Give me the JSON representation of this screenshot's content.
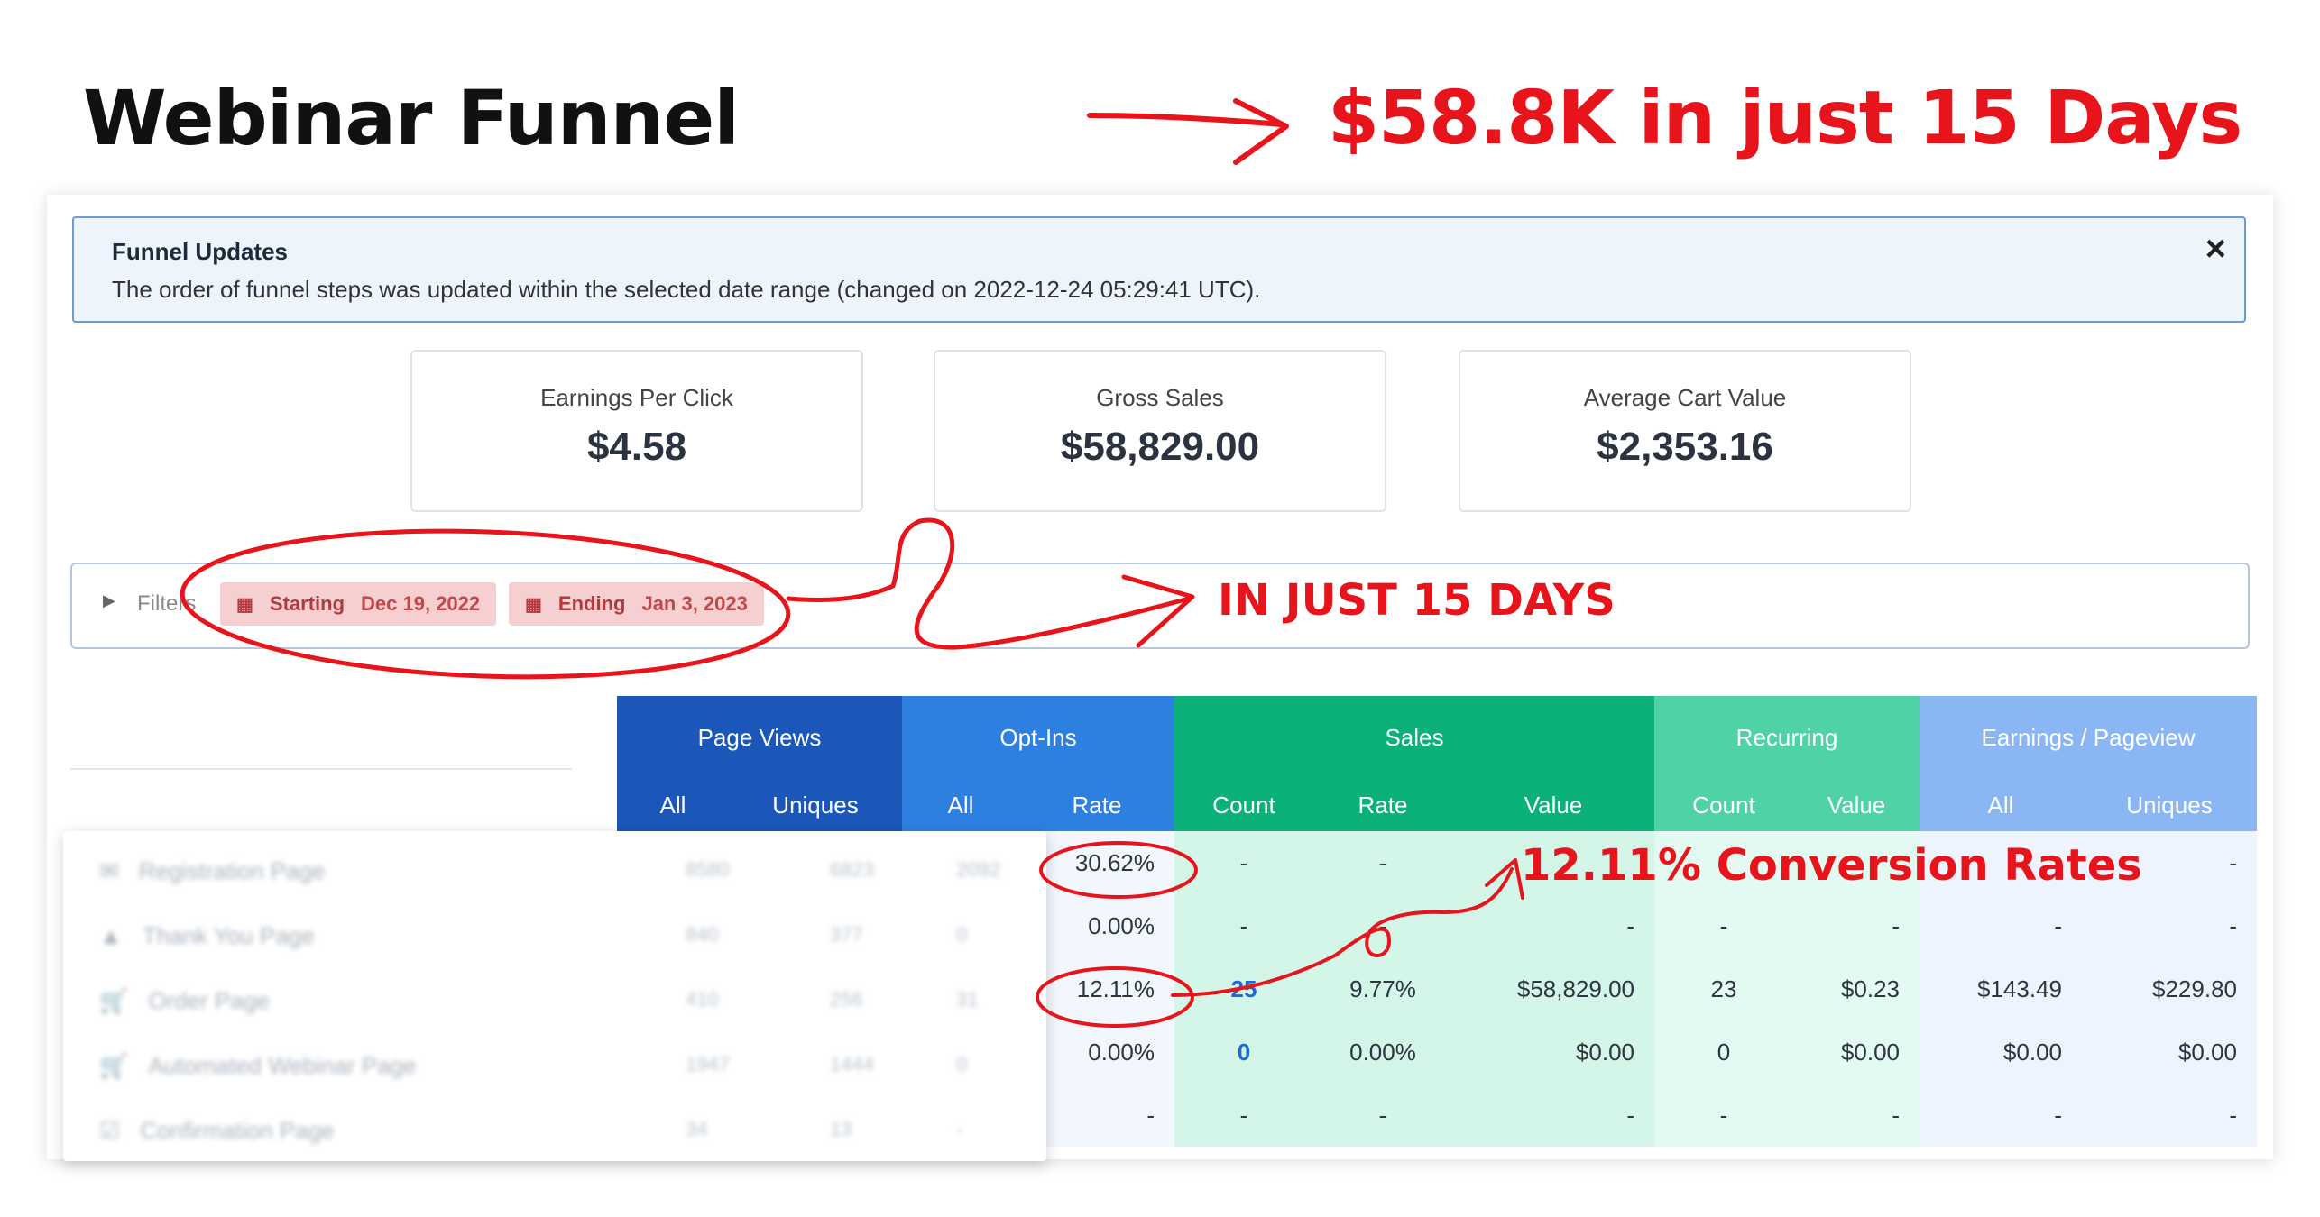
{
  "heading": "Webinar Funnel",
  "headline": "$58.8K in just 15 Days",
  "annotations": {
    "days": "IN JUST 15 DAYS",
    "conversion": "12.11% Conversion Rates"
  },
  "alert": {
    "title": "Funnel Updates",
    "text": "The order of funnel steps was updated within the selected date range (changed on 2022-12-24 05:29:41 UTC).",
    "close": "×"
  },
  "stats": [
    {
      "label": "Earnings Per Click",
      "value": "$4.58"
    },
    {
      "label": "Gross Sales",
      "value": "$58,829.00"
    },
    {
      "label": "Average Cart Value",
      "value": "$2,353.16"
    }
  ],
  "filters": {
    "label": "Filters",
    "start_label": "Starting",
    "start_date": "Dec 19, 2022",
    "end_label": "Ending",
    "end_date": "Jan 3, 2023"
  },
  "table": {
    "groups": [
      "Page Views",
      "Opt-Ins",
      "Sales",
      "Recurring",
      "Earnings / Pageview"
    ],
    "subheaders": [
      "All",
      "Uniques",
      "All",
      "Rate",
      "Count",
      "Rate",
      "Value",
      "Count",
      "Value",
      "All",
      "Uniques"
    ],
    "rows": [
      [
        "",
        "",
        "",
        "30.62%",
        "-",
        "-",
        "",
        "",
        "",
        "-",
        "-"
      ],
      [
        "",
        "",
        "",
        "0.00%",
        "-",
        "-",
        "-",
        "-",
        "-",
        "-",
        "-"
      ],
      [
        "",
        "",
        "",
        "12.11%",
        "25",
        "9.77%",
        "$58,829.00",
        "23",
        "$0.23",
        "$143.49",
        "$229.80"
      ],
      [
        "",
        "",
        "",
        "0.00%",
        "0",
        "0.00%",
        "$0.00",
        "0",
        "$0.00",
        "$0.00",
        "$0.00"
      ],
      [
        "",
        "",
        "",
        "-",
        "-",
        "-",
        "-",
        "-",
        "-",
        "-",
        "-"
      ]
    ]
  },
  "blurred_steps": [
    "Registration Page",
    "Thank You Page",
    "Order Page",
    "Automated Webinar Page",
    "Confirmation Page"
  ],
  "blurred_numbers": [
    [
      "8580",
      "6823",
      "2092"
    ],
    [
      "840",
      "377",
      "0"
    ],
    [
      "410",
      "256",
      "31"
    ],
    [
      "1947",
      "1444",
      "0"
    ],
    [
      "34",
      "13",
      "-"
    ]
  ],
  "colors": {
    "annotation": "#e8141b"
  }
}
